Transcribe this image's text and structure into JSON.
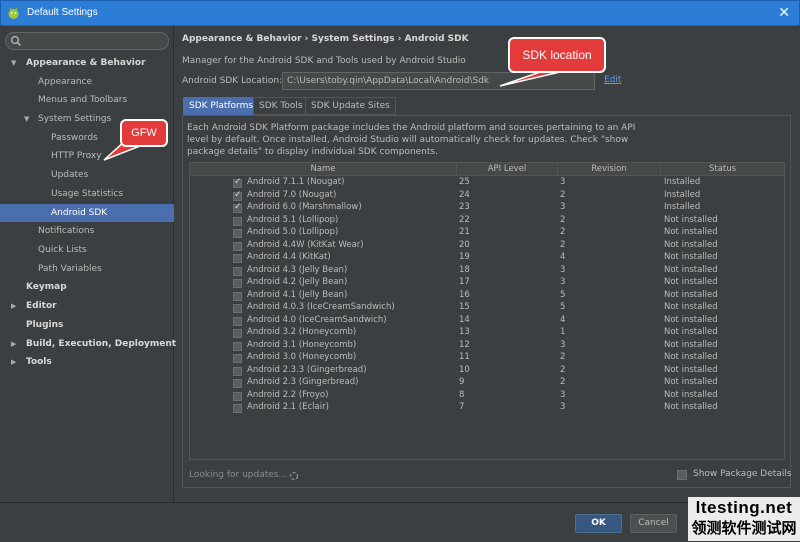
{
  "window": {
    "title": "Default Settings",
    "close_label": "✕"
  },
  "sidebar": {
    "search_placeholder": "",
    "items": [
      {
        "label": "Appearance & Behavior",
        "expanded": true
      },
      {
        "label": "Appearance"
      },
      {
        "label": "Menus and Toolbars"
      },
      {
        "label": "System Settings",
        "expanded": true
      },
      {
        "label": "Passwords"
      },
      {
        "label": "HTTP Proxy"
      },
      {
        "label": "Updates"
      },
      {
        "label": "Usage Statistics"
      },
      {
        "label": "Android SDK",
        "selected": true
      },
      {
        "label": "Notifications"
      },
      {
        "label": "Quick Lists"
      },
      {
        "label": "Path Variables"
      },
      {
        "label": "Keymap"
      },
      {
        "label": "Editor",
        "expanded": false
      },
      {
        "label": "Plugins"
      },
      {
        "label": "Build, Execution, Deployment",
        "expanded": false
      },
      {
        "label": "Tools",
        "expanded": false
      }
    ]
  },
  "main": {
    "breadcrumb": "Appearance & Behavior › System Settings › Android SDK",
    "description": "Manager for the Android SDK and Tools used by Android Studio",
    "sdk_location_label": "Android SDK Location:",
    "sdk_location_value": "C:\\Users\\toby.qin\\AppData\\Local\\Android\\Sdk",
    "edit_label": "Edit",
    "tabs": [
      {
        "label": "SDK Platforms",
        "active": true
      },
      {
        "label": "SDK Tools"
      },
      {
        "label": "SDK Update Sites"
      }
    ],
    "info_text": "Each Android SDK Platform package includes the Android platform and sources pertaining to an API level by default. Once installed, Android Studio will automatically check for updates. Check \"show package details\" to display individual SDK components.",
    "table": {
      "columns": [
        "Name",
        "API Level",
        "Revision",
        "Status"
      ],
      "rows": [
        {
          "checked": true,
          "name": "Android 7.1.1 (Nougat)",
          "api": "25",
          "revision": "3",
          "status": "Installed"
        },
        {
          "checked": true,
          "name": "Android 7.0 (Nougat)",
          "api": "24",
          "revision": "2",
          "status": "Installed"
        },
        {
          "checked": true,
          "name": "Android 6.0 (Marshmallow)",
          "api": "23",
          "revision": "3",
          "status": "Installed"
        },
        {
          "checked": false,
          "name": "Android 5.1 (Lollipop)",
          "api": "22",
          "revision": "2",
          "status": "Not installed"
        },
        {
          "checked": false,
          "name": "Android 5.0 (Lollipop)",
          "api": "21",
          "revision": "2",
          "status": "Not installed"
        },
        {
          "checked": false,
          "name": "Android 4.4W (KitKat Wear)",
          "api": "20",
          "revision": "2",
          "status": "Not installed"
        },
        {
          "checked": false,
          "name": "Android 4.4 (KitKat)",
          "api": "19",
          "revision": "4",
          "status": "Not installed"
        },
        {
          "checked": false,
          "name": "Android 4.3 (Jelly Bean)",
          "api": "18",
          "revision": "3",
          "status": "Not installed"
        },
        {
          "checked": false,
          "name": "Android 4.2 (Jelly Bean)",
          "api": "17",
          "revision": "3",
          "status": "Not installed"
        },
        {
          "checked": false,
          "name": "Android 4.1 (Jelly Bean)",
          "api": "16",
          "revision": "5",
          "status": "Not installed"
        },
        {
          "checked": false,
          "name": "Android 4.0.3 (IceCreamSandwich)",
          "api": "15",
          "revision": "5",
          "status": "Not installed"
        },
        {
          "checked": false,
          "name": "Android 4.0 (IceCreamSandwich)",
          "api": "14",
          "revision": "4",
          "status": "Not installed"
        },
        {
          "checked": false,
          "name": "Android 3.2 (Honeycomb)",
          "api": "13",
          "revision": "1",
          "status": "Not installed"
        },
        {
          "checked": false,
          "name": "Android 3.1 (Honeycomb)",
          "api": "12",
          "revision": "3",
          "status": "Not installed"
        },
        {
          "checked": false,
          "name": "Android 3.0 (Honeycomb)",
          "api": "11",
          "revision": "2",
          "status": "Not installed"
        },
        {
          "checked": false,
          "name": "Android 2.3.3 (Gingerbread)",
          "api": "10",
          "revision": "2",
          "status": "Not installed"
        },
        {
          "checked": false,
          "name": "Android 2.3 (Gingerbread)",
          "api": "9",
          "revision": "2",
          "status": "Not installed"
        },
        {
          "checked": false,
          "name": "Android 2.2 (Froyo)",
          "api": "8",
          "revision": "3",
          "status": "Not installed"
        },
        {
          "checked": false,
          "name": "Android 2.1 (Eclair)",
          "api": "7",
          "revision": "3",
          "status": "Not installed"
        }
      ]
    },
    "looking_for_updates": "Looking for updates...",
    "show_package_details": "Show Package Details"
  },
  "footer": {
    "ok_label": "OK",
    "cancel_label": "Cancel"
  },
  "annotations": {
    "sdk_location_callout": "SDK location",
    "gfw_callout": "GFW",
    "callout_color": "#e33b3b"
  },
  "watermark": {
    "line1": "ltesting.net",
    "line2": "领测软件测试网"
  },
  "colors": {
    "titlebar": "#2b7dd6",
    "background": "#3c3f41",
    "selection": "#4b6eaf",
    "link": "#589df6",
    "ok_button": "#365880"
  }
}
